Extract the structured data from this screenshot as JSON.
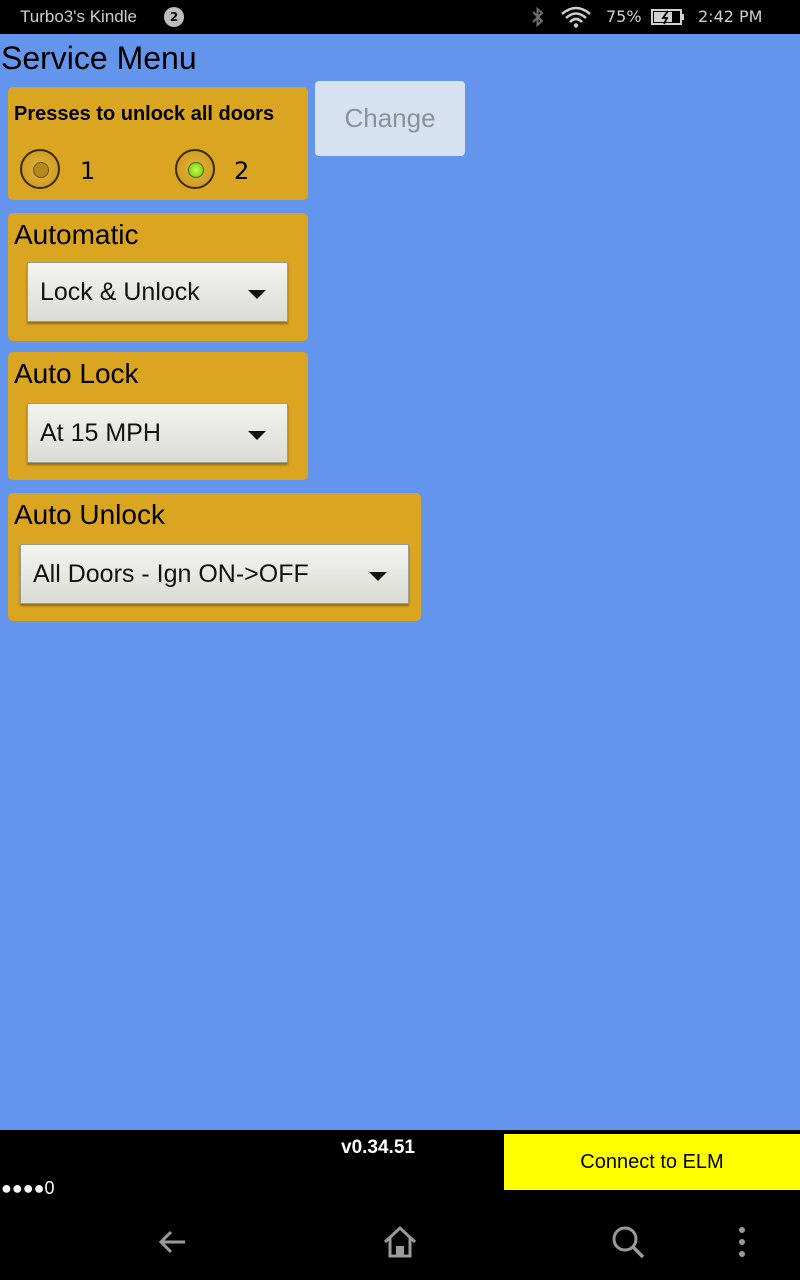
{
  "status_bar": {
    "device_name": "Turbo3's Kindle",
    "notification_count": "2",
    "battery_percent": "75%",
    "time": "2:42 PM"
  },
  "page": {
    "title": "Service Menu"
  },
  "presses": {
    "heading": "Presses to unlock all doors",
    "options": [
      {
        "label": "1",
        "checked": false
      },
      {
        "label": "2",
        "checked": true
      }
    ],
    "change_label": "Change"
  },
  "automatic": {
    "heading": "Automatic",
    "selected": "Lock & Unlock"
  },
  "auto_lock": {
    "heading": "Auto Lock",
    "selected": "At 15 MPH"
  },
  "auto_unlock": {
    "heading": "Auto Unlock",
    "selected": "All Doors - Ign ON->OFF"
  },
  "footer": {
    "version": "v0.34.51",
    "signal": "●●●●0",
    "connect_label": "Connect to ELM"
  },
  "colors": {
    "background": "#6495ED",
    "panel": "#DAA520",
    "connect_button": "#FFFF00"
  }
}
